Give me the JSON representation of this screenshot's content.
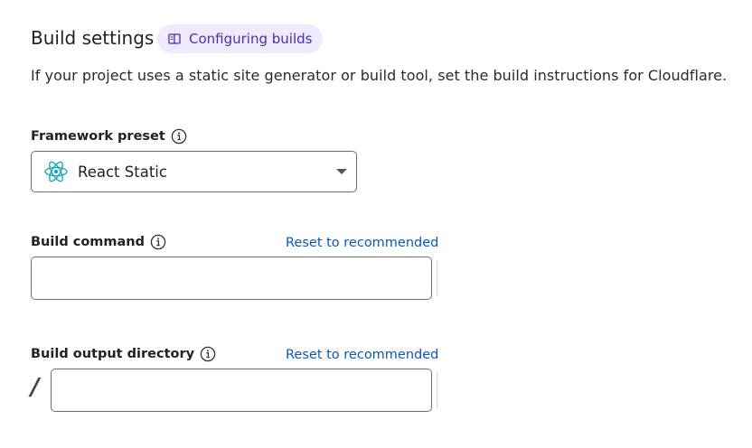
{
  "header": {
    "title": "Build settings",
    "docs_link": {
      "label": "Configuring builds",
      "icon": "book-icon"
    }
  },
  "description": "If your project uses a static site generator or build tool, set the build instructions for Cloudflare.",
  "framework_preset": {
    "label": "Framework preset",
    "info_icon": "info-icon",
    "selected": "React Static",
    "selected_icon": "react-icon",
    "dropdown_icon": "caret-down-icon"
  },
  "build_command": {
    "label": "Build command",
    "info_icon": "info-icon",
    "reset_label": "Reset to recommended",
    "value": ""
  },
  "build_output_directory": {
    "label": "Build output directory",
    "info_icon": "info-icon",
    "reset_label": "Reset to recommended",
    "prefix": "/",
    "value": ""
  },
  "colors": {
    "pill_bg": "#efeafc",
    "pill_text": "#4a2fa8",
    "link": "#0b57b6",
    "react_icon": "#1aa6b7",
    "border": "#6e6e6e"
  }
}
